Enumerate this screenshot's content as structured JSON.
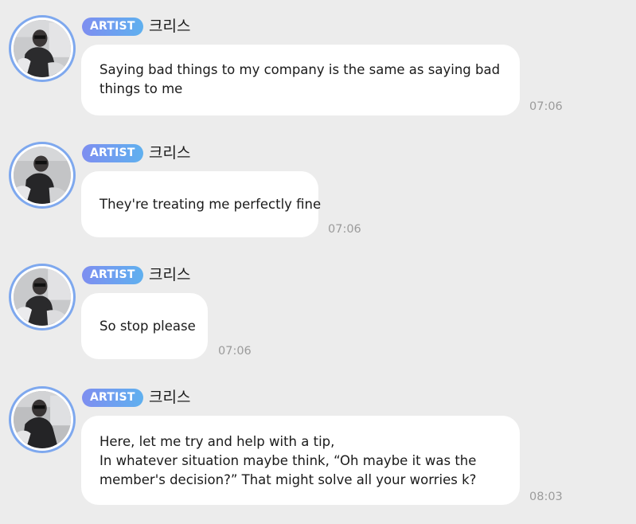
{
  "messages": [
    {
      "badge": "ARTIST",
      "sender": "크리스",
      "lines": [
        "Saying bad things to my company is the same as saying bad",
        "things to me"
      ],
      "time": "07:06"
    },
    {
      "badge": "ARTIST",
      "sender": "크리스",
      "lines": [
        "They're treating me perfectly fine"
      ],
      "time": "07:06"
    },
    {
      "badge": "ARTIST",
      "sender": "크리스",
      "lines": [
        "So stop please"
      ],
      "time": "07:06"
    },
    {
      "badge": "ARTIST",
      "sender": "크리스",
      "lines": [
        "Here, let me try and help with a tip,",
        "In whatever situation maybe think, “Oh maybe it was the",
        "member's decision?” That might solve all your worries k?"
      ],
      "time": "08:03"
    }
  ],
  "colors": {
    "background": "#ececec",
    "bubble": "#ffffff",
    "badge_start": "#7e8ef0",
    "badge_end": "#5fb0ef",
    "avatar_ring": "#7ea8ee",
    "timestamp": "#9b9b9b"
  }
}
